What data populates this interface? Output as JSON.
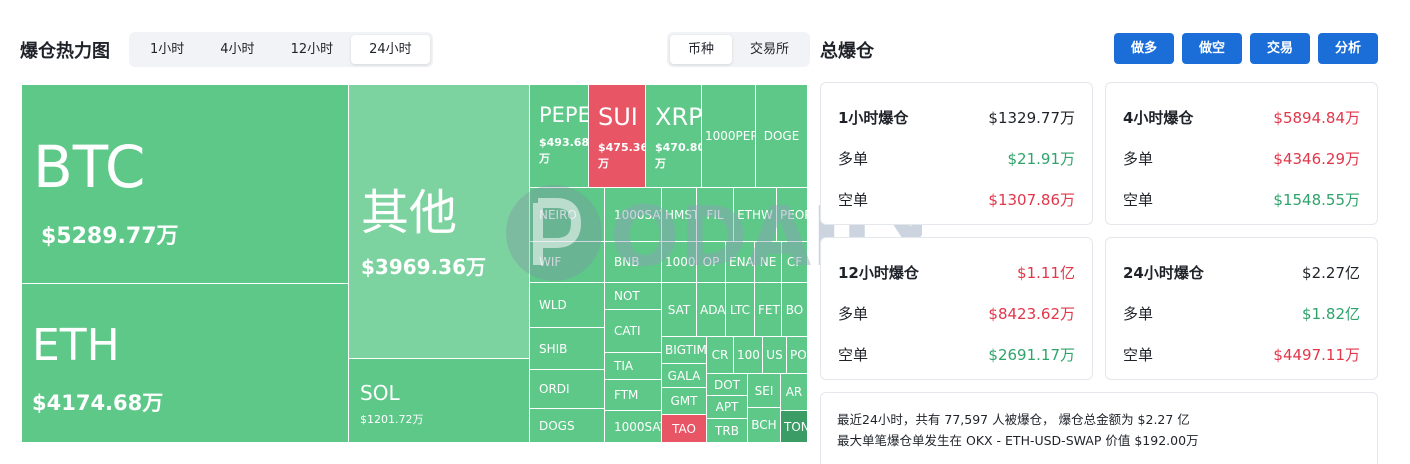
{
  "heatmap": {
    "title": "爆仓热力图",
    "time_tabs": [
      "1小时",
      "4小时",
      "12小时",
      "24小时"
    ],
    "active_time_tab": "24小时",
    "type_tabs": [
      "币种",
      "交易所"
    ],
    "active_type_tab": "币种"
  },
  "total": {
    "title": "总爆仓",
    "buttons": [
      "做多",
      "做空",
      "交易",
      "分析"
    ]
  },
  "treemap": {
    "big": [
      {
        "symbol": "BTC",
        "value": "$5289.77万"
      },
      {
        "symbol": "ETH",
        "value": "$4174.68万"
      },
      {
        "symbol": "其他",
        "value": "$3969.36万"
      },
      {
        "symbol": "SOL",
        "value": "$1201.72万"
      },
      {
        "symbol": "PEPE",
        "value": "$493.68万"
      },
      {
        "symbol": "SUI",
        "value": "$475.36万"
      },
      {
        "symbol": "XRP",
        "value": "$470.80万"
      }
    ],
    "small": [
      "1000PEPE",
      "DOGE",
      "NEIRO",
      "1000SATS",
      "HMSTR",
      "FIL",
      "ETHW",
      "PEOPLE",
      "WIF",
      "BNB",
      "1000",
      "OP",
      "ENA",
      "NE",
      "CF",
      "WLD",
      "NOT",
      "SAT",
      "ADA",
      "LTC",
      "FET",
      "BO",
      "CATI",
      "SHIB",
      "TIA",
      "BIGTIME",
      "CR",
      "100",
      "US",
      "PO",
      "ORDI",
      "GALA",
      "FTM",
      "DOT",
      "SEI",
      "AR",
      "GMT",
      "APT",
      "DOGS",
      "1000SATS",
      "TAO",
      "TRB",
      "BCH",
      "TON"
    ]
  },
  "cards": [
    {
      "title": "1小时爆仓",
      "total": "$1329.77万",
      "total_color": "#1f2329",
      "long_label": "多单",
      "long": "$21.91万",
      "long_color": "#2fa36b",
      "short_label": "空单",
      "short": "$1307.86万",
      "short_color": "#e2364a"
    },
    {
      "title": "4小时爆仓",
      "total": "$5894.84万",
      "total_color": "#e2364a",
      "long_label": "多单",
      "long": "$4346.29万",
      "long_color": "#e2364a",
      "short_label": "空单",
      "short": "$1548.55万",
      "short_color": "#2fa36b"
    },
    {
      "title": "12小时爆仓",
      "total": "$1.11亿",
      "total_color": "#e2364a",
      "long_label": "多单",
      "long": "$8423.62万",
      "long_color": "#e2364a",
      "short_label": "空单",
      "short": "$2691.17万",
      "short_color": "#2fa36b"
    },
    {
      "title": "24小时爆仓",
      "total": "$2.27亿",
      "total_color": "#1f2329",
      "long_label": "多单",
      "long": "$1.82亿",
      "long_color": "#2fa36b",
      "short_label": "空单",
      "short": "$4497.11万",
      "short_color": "#e2364a"
    }
  ],
  "summary": {
    "line1": "最近24小时，共有 77,597 人被爆仓， 爆仓总金额为 $2.27 亿",
    "line2": "最大单笔爆仓单发生在 OKX - ETH-USD-SWAP 价值 $192.00万"
  },
  "watermark": "ODAILY",
  "colors": {
    "up": "#2fa36b",
    "down": "#e2364a",
    "tile": "#5ec889",
    "tile_light": "#7dd3a0",
    "tile_red": "#e85565",
    "accent": "#1b6ed8"
  }
}
